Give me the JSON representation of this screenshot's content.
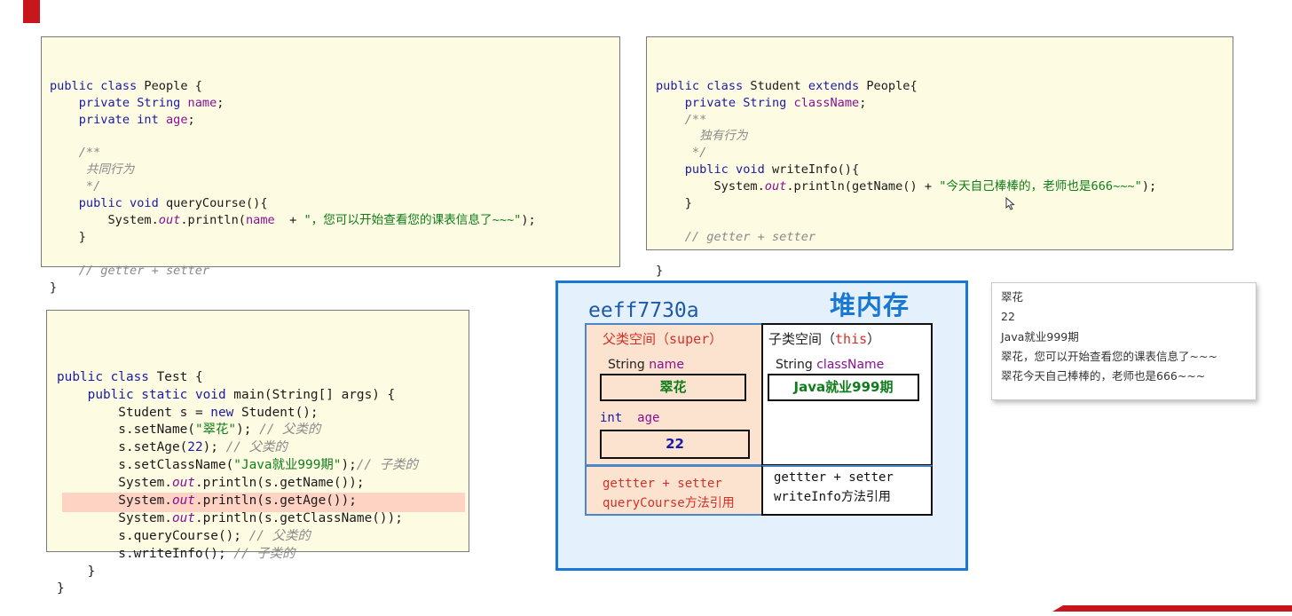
{
  "code_people": {
    "lines": [
      [
        [
          "kw",
          "public class "
        ],
        [
          "",
          "People {"
        ]
      ],
      [
        [
          "",
          "    "
        ],
        [
          "kw",
          "private "
        ],
        [
          "ty",
          "String "
        ],
        [
          "fld",
          "name"
        ],
        [
          "",
          ";"
        ]
      ],
      [
        [
          "",
          "    "
        ],
        [
          "kw",
          "private int "
        ],
        [
          "fld",
          "age"
        ],
        [
          "",
          ";"
        ]
      ],
      [
        [
          "",
          ""
        ]
      ],
      [
        [
          "",
          "    "
        ],
        [
          "cm",
          "/**"
        ]
      ],
      [
        [
          "",
          "     "
        ],
        [
          "cm",
          "共同行为"
        ]
      ],
      [
        [
          "",
          "     "
        ],
        [
          "cm",
          "*/"
        ]
      ],
      [
        [
          "",
          "    "
        ],
        [
          "kw",
          "public void "
        ],
        [
          "",
          "queryCourse(){"
        ]
      ],
      [
        [
          "",
          "        System."
        ],
        [
          "st",
          "out"
        ],
        [
          "",
          ".println("
        ],
        [
          "fld",
          "name"
        ],
        [
          "",
          "  + "
        ],
        [
          "str",
          "\"，您可以开始查看您的课表信息了~~~\""
        ],
        [
          "",
          ");"
        ]
      ],
      [
        [
          "",
          "    }"
        ]
      ],
      [
        [
          "",
          ""
        ]
      ],
      [
        [
          "",
          "    "
        ],
        [
          "cm",
          "// getter + setter"
        ]
      ],
      [
        [
          "",
          "}"
        ]
      ]
    ]
  },
  "code_student": {
    "lines": [
      [
        [
          "kw",
          "public class "
        ],
        [
          "",
          "Student "
        ],
        [
          "kw",
          "extends "
        ],
        [
          "",
          "People{"
        ]
      ],
      [
        [
          "",
          "    "
        ],
        [
          "kw",
          "private "
        ],
        [
          "ty",
          "String "
        ],
        [
          "fld",
          "className"
        ],
        [
          "",
          ";"
        ]
      ],
      [
        [
          "",
          "    "
        ],
        [
          "cm",
          "/**"
        ]
      ],
      [
        [
          "",
          "      "
        ],
        [
          "cm",
          "独有行为"
        ]
      ],
      [
        [
          "",
          "     "
        ],
        [
          "cm",
          "*/"
        ]
      ],
      [
        [
          "",
          "    "
        ],
        [
          "kw",
          "public void "
        ],
        [
          "",
          "writeInfo(){"
        ]
      ],
      [
        [
          "",
          "        System."
        ],
        [
          "st",
          "out"
        ],
        [
          "",
          ".println(getName() + "
        ],
        [
          "str",
          "\"今天自己棒棒的，老师也是666~~~\""
        ],
        [
          "",
          ");"
        ]
      ],
      [
        [
          "",
          "    }"
        ]
      ],
      [
        [
          "",
          ""
        ]
      ],
      [
        [
          "",
          "    "
        ],
        [
          "cm",
          "// getter + setter"
        ]
      ],
      [
        [
          "",
          ""
        ]
      ],
      [
        [
          "",
          "}"
        ]
      ]
    ]
  },
  "code_test": {
    "lines": [
      [
        [
          "kw",
          "public class "
        ],
        [
          "",
          "Test {"
        ]
      ],
      [
        [
          "",
          "    "
        ],
        [
          "kw",
          "public static void "
        ],
        [
          "",
          "main(String[] args) {"
        ]
      ],
      [
        [
          "",
          "        Student s = "
        ],
        [
          "kw",
          "new "
        ],
        [
          "",
          "Student();"
        ]
      ],
      [
        [
          "",
          "        s.setName("
        ],
        [
          "str",
          "\"翠花\""
        ],
        [
          "",
          "); "
        ],
        [
          "cm",
          "// 父类的"
        ]
      ],
      [
        [
          "",
          "        s.setAge("
        ],
        [
          "kw",
          "22"
        ],
        [
          "",
          "); "
        ],
        [
          "cm",
          "// 父类的"
        ]
      ],
      [
        [
          "",
          "        s.setClassName("
        ],
        [
          "str",
          "\"Java就业999期\""
        ],
        [
          "",
          ");"
        ],
        [
          "cm",
          "// 子类的"
        ]
      ],
      [
        [
          "",
          "        System."
        ],
        [
          "st",
          "out"
        ],
        [
          "",
          ".println(s.getName());"
        ]
      ],
      [
        [
          "",
          "        System."
        ],
        [
          "st",
          "out"
        ],
        [
          "",
          ".println(s.getAge());"
        ]
      ],
      [
        [
          "",
          "        System."
        ],
        [
          "st",
          "out"
        ],
        [
          "",
          ".println(s.getClassName());"
        ]
      ],
      [
        [
          "",
          "        s.queryCourse(); "
        ],
        [
          "cm",
          "// 父类的"
        ]
      ],
      [
        [
          "",
          "        s.writeInfo(); "
        ],
        [
          "cm",
          "// 子类的"
        ]
      ],
      [
        [
          "",
          "    }"
        ]
      ],
      [
        [
          "",
          "}"
        ]
      ]
    ]
  },
  "heap": {
    "title": "堆内存",
    "address": "eeff7730a",
    "parent_label": "父类空间（",
    "parent_kw": "super",
    "parent_close": "）",
    "child_label": "子类空间（",
    "child_kw": "this",
    "child_close": "）",
    "name_type": "String ",
    "name_field": "name",
    "name_value": "翠花",
    "age_type": "int",
    "age_field": "age",
    "age_value": "22",
    "classname_type": "String ",
    "classname_field": "className",
    "classname_value": "Java就业999期",
    "parent_methods_1": "gettter + setter",
    "parent_methods_2": "queryCourse方法引用",
    "child_methods_1": "gettter + setter",
    "child_methods_2": "writeInfo方法引用"
  },
  "console": {
    "lines": [
      "翠花",
      "22",
      "Java就业999期",
      "翠花，您可以开始查看您的课表信息了~~~",
      "翠花今天自己棒棒的，老师也是666~~~"
    ]
  },
  "colors": {
    "accent_red": "#c8161d",
    "heap_blue": "#1978d4",
    "super_red": "#d3302a",
    "value_green": "#0f7d1b",
    "value_blue": "#1a1aa6"
  }
}
